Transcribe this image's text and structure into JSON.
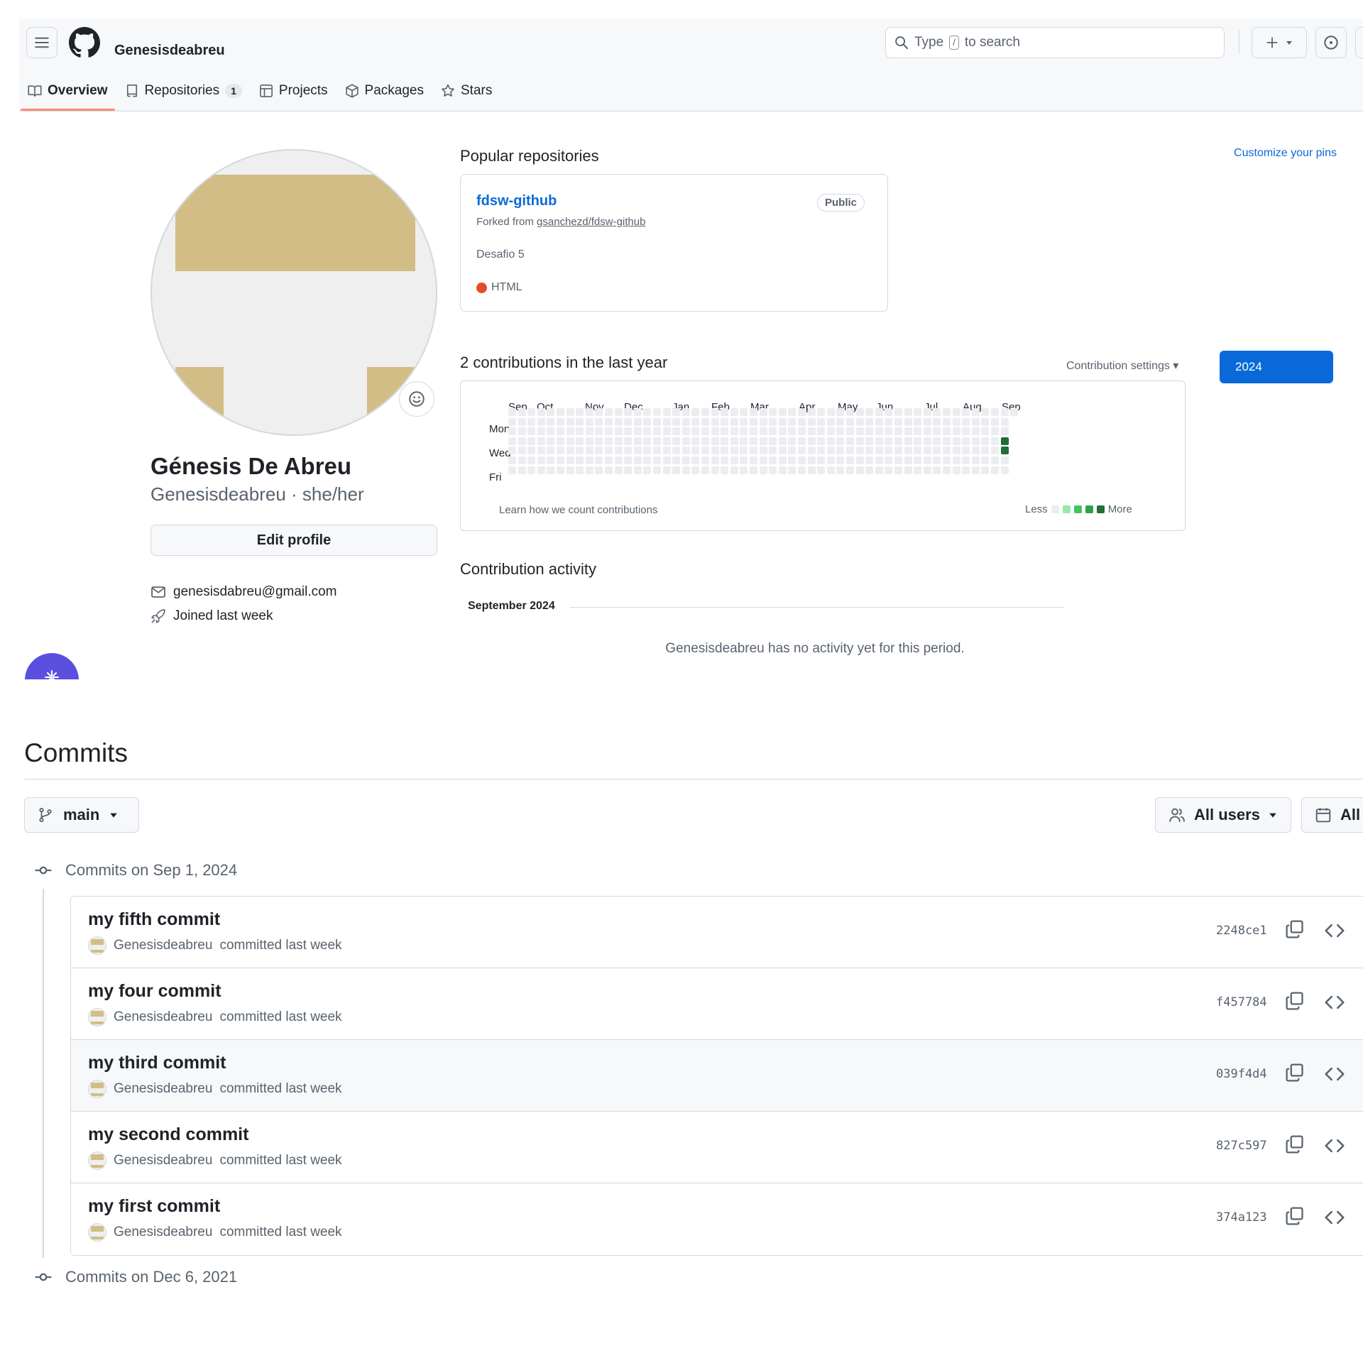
{
  "header": {
    "username": "Genesisdeabreu",
    "search_prefix": "Type",
    "search_key": "/",
    "search_suffix": "to search"
  },
  "tabs": [
    {
      "label": "Overview",
      "icon": "book-icon",
      "selected": true
    },
    {
      "label": "Repositories",
      "icon": "repo-icon",
      "count": "1"
    },
    {
      "label": "Projects",
      "icon": "table-icon"
    },
    {
      "label": "Packages",
      "icon": "package-icon"
    },
    {
      "label": "Stars",
      "icon": "star-icon"
    }
  ],
  "profile": {
    "name": "Génesis De Abreu",
    "login_line": "Genesisdeabreu · she/her",
    "edit_label": "Edit profile",
    "email": "genesisdabreu@gmail.com",
    "joined": "Joined last week"
  },
  "popular": {
    "title": "Popular repositories",
    "customize": "Customize your pins",
    "repo": {
      "name": "fdsw-github",
      "visibility": "Public",
      "forked_prefix": "Forked from",
      "forked_from": "gsanchezd/fdsw-github",
      "description": "Desafio 5",
      "language": "HTML",
      "language_color": "#e34c26"
    }
  },
  "contributions": {
    "title": "2 contributions in the last year",
    "settings": "Contribution settings ▾",
    "year": "2024",
    "months": [
      "Sep",
      "Oct",
      "Nov",
      "Dec",
      "Jan",
      "Feb",
      "Mar",
      "Apr",
      "May",
      "Jun",
      "Jul",
      "Aug",
      "Sep"
    ],
    "day_labels": [
      "Mon",
      "Wed",
      "Fri"
    ],
    "learn": "Learn how we count contributions",
    "less": "Less",
    "more": "More",
    "legend_colors": [
      "#ebedf0",
      "#9be9a8",
      "#40c463",
      "#30a14e",
      "#216e39"
    ],
    "active_color": "#216e39"
  },
  "activity": {
    "title": "Contribution activity",
    "month": "September 2024",
    "empty": "Genesisdeabreu has no activity yet for this period."
  },
  "commits_page": {
    "title": "Commits",
    "branch": "main",
    "users": "All users",
    "time": "All",
    "groups": [
      {
        "heading": "Commits on Sep 1, 2024"
      },
      {
        "heading": "Commits on Dec 6, 2021"
      }
    ],
    "commits": [
      {
        "message": "my fifth commit",
        "author": "Genesisdeabreu",
        "when": "committed last week",
        "sha": "2248ce1"
      },
      {
        "message": "my four commit",
        "author": "Genesisdeabreu",
        "when": "committed last week",
        "sha": "f457784"
      },
      {
        "message": "my third commit",
        "author": "Genesisdeabreu",
        "when": "committed last week",
        "sha": "039f4d4"
      },
      {
        "message": "my second commit",
        "author": "Genesisdeabreu",
        "when": "committed last week",
        "sha": "827c597"
      },
      {
        "message": "my first commit",
        "author": "Genesisdeabreu",
        "when": "committed last week",
        "sha": "374a123"
      }
    ]
  }
}
